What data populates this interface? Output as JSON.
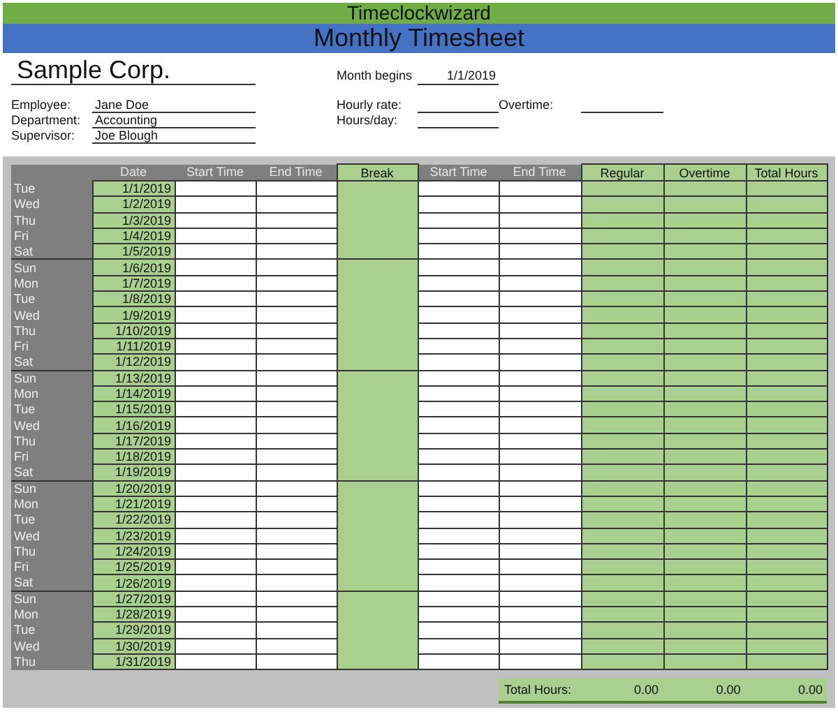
{
  "banner": "Timeclockwizard",
  "title": "Monthly Timesheet",
  "company": "Sample Corp.",
  "month_begins": {
    "label": "Month begins",
    "value": "1/1/2019"
  },
  "employee_fields": [
    {
      "label": "Employee:",
      "value": "Jane Doe"
    },
    {
      "label": "Department:",
      "value": "Accounting"
    },
    {
      "label": "Supervisor:",
      "value": "Joe Blough"
    }
  ],
  "rate_fields": [
    [
      {
        "label": "Hourly rate:"
      },
      {
        "label": "Overtime:"
      }
    ],
    [
      {
        "label": "Hours/day:"
      }
    ]
  ],
  "table": {
    "columns": [
      {
        "kind": "day"
      },
      {
        "kind": "date",
        "label": "Date"
      },
      {
        "kind": "entry",
        "label": "Start Time"
      },
      {
        "kind": "entry",
        "label": "End Time"
      },
      {
        "kind": "break",
        "label": "Break"
      },
      {
        "kind": "entry",
        "label": "Start Time"
      },
      {
        "kind": "entry",
        "label": "End Time"
      },
      {
        "kind": "result",
        "label": "Regular"
      },
      {
        "kind": "result",
        "label": "Overtime"
      },
      {
        "kind": "result",
        "label": "Total Hours"
      }
    ],
    "weeks": [
      [
        {
          "day": "Tue",
          "date": "1/1/2019"
        },
        {
          "day": "Wed",
          "date": "1/2/2019"
        },
        {
          "day": "Thu",
          "date": "1/3/2019"
        },
        {
          "day": "Fri",
          "date": "1/4/2019"
        },
        {
          "day": "Sat",
          "date": "1/5/2019"
        }
      ],
      [
        {
          "day": "Sun",
          "date": "1/6/2019"
        },
        {
          "day": "Mon",
          "date": "1/7/2019"
        },
        {
          "day": "Tue",
          "date": "1/8/2019"
        },
        {
          "day": "Wed",
          "date": "1/9/2019"
        },
        {
          "day": "Thu",
          "date": "1/10/2019"
        },
        {
          "day": "Fri",
          "date": "1/11/2019"
        },
        {
          "day": "Sat",
          "date": "1/12/2019"
        }
      ],
      [
        {
          "day": "Sun",
          "date": "1/13/2019"
        },
        {
          "day": "Mon",
          "date": "1/14/2019"
        },
        {
          "day": "Tue",
          "date": "1/15/2019"
        },
        {
          "day": "Wed",
          "date": "1/16/2019"
        },
        {
          "day": "Thu",
          "date": "1/17/2019"
        },
        {
          "day": "Fri",
          "date": "1/18/2019"
        },
        {
          "day": "Sat",
          "date": "1/19/2019"
        }
      ],
      [
        {
          "day": "Sun",
          "date": "1/20/2019"
        },
        {
          "day": "Mon",
          "date": "1/21/2019"
        },
        {
          "day": "Tue",
          "date": "1/22/2019"
        },
        {
          "day": "Wed",
          "date": "1/23/2019"
        },
        {
          "day": "Thu",
          "date": "1/24/2019"
        },
        {
          "day": "Fri",
          "date": "1/25/2019"
        },
        {
          "day": "Sat",
          "date": "1/26/2019"
        }
      ],
      [
        {
          "day": "Sun",
          "date": "1/27/2019"
        },
        {
          "day": "Mon",
          "date": "1/28/2019"
        },
        {
          "day": "Tue",
          "date": "1/29/2019"
        },
        {
          "day": "Wed",
          "date": "1/30/2019"
        },
        {
          "day": "Thu",
          "date": "1/31/2019"
        }
      ]
    ]
  },
  "totals": {
    "label": "Total Hours:",
    "values": [
      "0.00",
      "0.00",
      "0.00"
    ]
  }
}
